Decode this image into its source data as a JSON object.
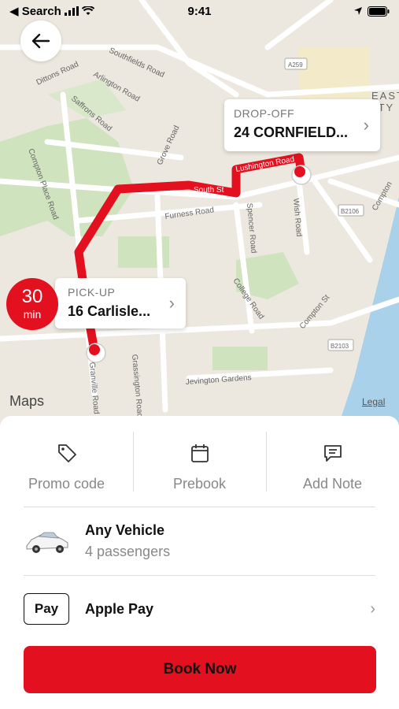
{
  "status_bar": {
    "back_app": "◀ Search",
    "time": "9:41"
  },
  "map": {
    "street_labels": [
      "Southfields Road",
      "Arlington Road",
      "Dittons Road",
      "Saffrons Road",
      "Grove Road",
      "Compton Place Road",
      "Lushington Road",
      "South St",
      "Furness Road",
      "Spencer Road",
      "Wish Road",
      "College Road",
      "Compton St",
      "Grassington Road",
      "Granville Road",
      "Jevington Gardens",
      "A259",
      "B2106",
      "B2103",
      "Compton",
      "EAST",
      "ITY"
    ],
    "maps_logo": "Maps",
    "legal": "Legal",
    "colors": {
      "route": "#e3101f",
      "park": "#cfe3bf",
      "water": "#a9d2ea",
      "land": "#ece8df"
    }
  },
  "dropoff": {
    "label": "DROP-OFF",
    "value": "24 CORNFIELD..."
  },
  "pickup": {
    "label": "PICK-UP",
    "value": "16 Carlisle..."
  },
  "eta": {
    "value": "30",
    "unit": "min"
  },
  "options": [
    {
      "label": "Promo code",
      "icon": "tag-icon"
    },
    {
      "label": "Prebook",
      "icon": "calendar-icon"
    },
    {
      "label": "Add Note",
      "icon": "message-icon"
    }
  ],
  "vehicle": {
    "name": "Any Vehicle",
    "passengers": "4 passengers",
    "icon": "car-icon"
  },
  "payment": {
    "badge": "Pay",
    "label": "Apple Pay"
  },
  "book_button": "Book Now"
}
